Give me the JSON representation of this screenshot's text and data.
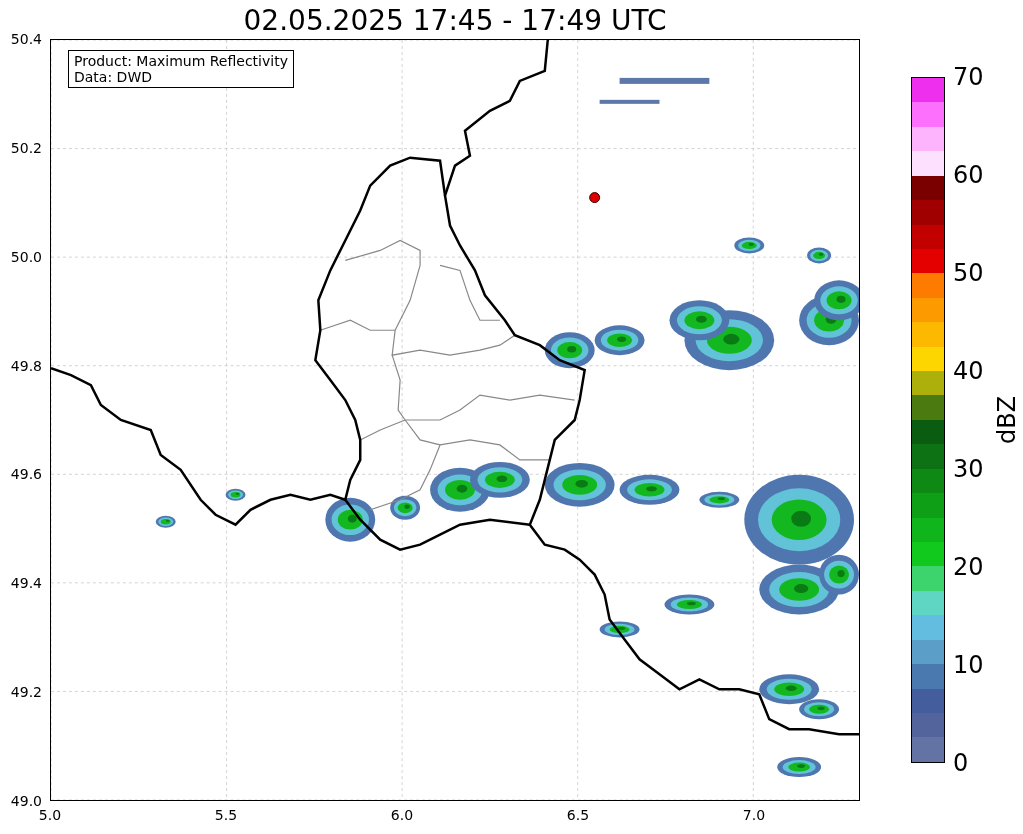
{
  "title": "02.05.2025 17:45 - 17:49 UTC",
  "info_box": {
    "lines": [
      "Product: Maximum Reflectivity",
      "Data: DWD"
    ]
  },
  "x_axis": {
    "ticks": [
      "5.0",
      "5.5",
      "6.0",
      "6.5",
      "7.0"
    ]
  },
  "y_axis": {
    "ticks": [
      "50.4",
      "50.2",
      "50.0",
      "49.8",
      "49.6",
      "49.4",
      "49.2",
      "49.0"
    ]
  },
  "colorbar": {
    "label": "dBZ",
    "ticks": [
      "70",
      "60",
      "50",
      "40",
      "30",
      "20",
      "10",
      "0"
    ],
    "segments": [
      {
        "color": "#ee30ee"
      },
      {
        "color": "#fd70fd"
      },
      {
        "color": "#fdb4fd"
      },
      {
        "color": "#fde0fd"
      },
      {
        "color": "#7a0000"
      },
      {
        "color": "#a00000"
      },
      {
        "color": "#c20000"
      },
      {
        "color": "#e50000"
      },
      {
        "color": "#fd7c00"
      },
      {
        "color": "#fd9a00"
      },
      {
        "color": "#fdb800"
      },
      {
        "color": "#fdd600"
      },
      {
        "color": "#adb00a"
      },
      {
        "color": "#4a7a10"
      },
      {
        "color": "#0a5c10"
      },
      {
        "color": "#0c7213"
      },
      {
        "color": "#0e8a14"
      },
      {
        "color": "#0f9f16"
      },
      {
        "color": "#0fb51a"
      },
      {
        "color": "#10c91c"
      },
      {
        "color": "#3dd46e"
      },
      {
        "color": "#5fd6c4"
      },
      {
        "color": "#62bde0"
      },
      {
        "color": "#5b9ec8"
      },
      {
        "color": "#4a79b0"
      },
      {
        "color": "#445d9c"
      },
      {
        "color": "#53639c"
      },
      {
        "color": "#6373a3"
      }
    ]
  }
}
